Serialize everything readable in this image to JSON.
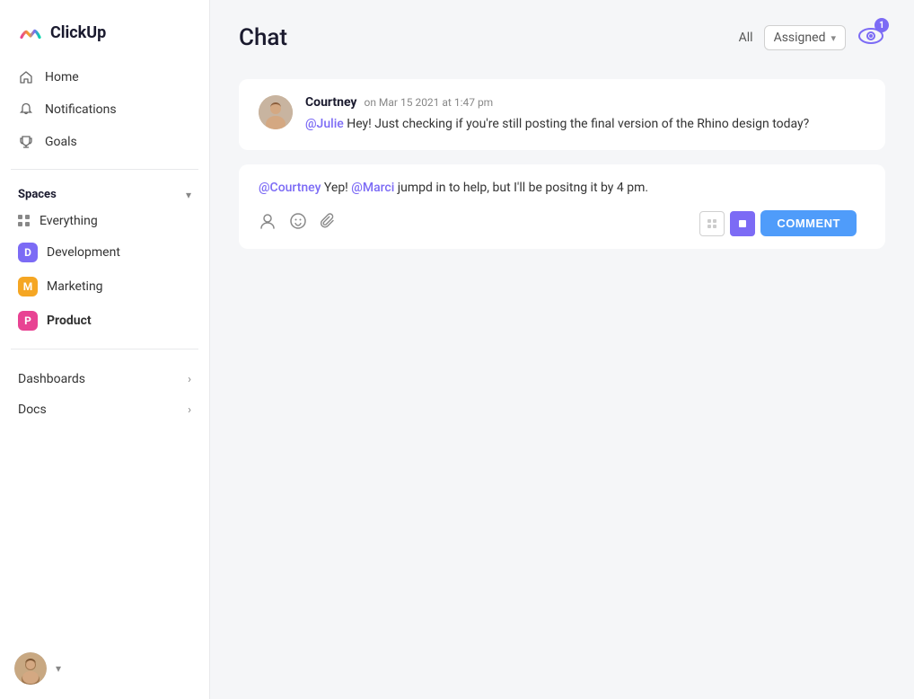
{
  "app": {
    "name": "ClickUp"
  },
  "sidebar": {
    "nav": [
      {
        "id": "home",
        "label": "Home",
        "icon": "home"
      },
      {
        "id": "notifications",
        "label": "Notifications",
        "icon": "bell"
      },
      {
        "id": "goals",
        "label": "Goals",
        "icon": "trophy"
      }
    ],
    "spaces_label": "Spaces",
    "spaces": [
      {
        "id": "everything",
        "label": "Everything",
        "type": "grid",
        "badge_color": null
      },
      {
        "id": "development",
        "label": "Development",
        "type": "badge",
        "badge_color": "#7c6bf5",
        "badge_letter": "D"
      },
      {
        "id": "marketing",
        "label": "Marketing",
        "type": "badge",
        "badge_color": "#f5a623",
        "badge_letter": "M"
      },
      {
        "id": "product",
        "label": "Product",
        "type": "badge",
        "badge_color": "#e84393",
        "badge_letter": "P",
        "active": true
      }
    ],
    "sections": [
      {
        "id": "dashboards",
        "label": "Dashboards"
      },
      {
        "id": "docs",
        "label": "Docs"
      }
    ],
    "user_avatar": "user"
  },
  "chat": {
    "title": "Chat",
    "filter_all": "All",
    "filter_assigned": "Assigned",
    "eye_badge_count": "1",
    "messages": [
      {
        "id": "msg1",
        "author": "Courtney",
        "timestamp": "on Mar 15 2021 at 1:47 pm",
        "mention": "@Julie",
        "text": " Hey! Just checking if you're still posting the final version of the Rhino design today?"
      }
    ],
    "reply": {
      "mention1": "@Courtney",
      "text1": " Yep! ",
      "mention2": "@Marci",
      "text2": " jumpd in to help, but I'll be positng it by 4 pm."
    },
    "toolbar": {
      "comment_button": "COMMENT"
    }
  }
}
